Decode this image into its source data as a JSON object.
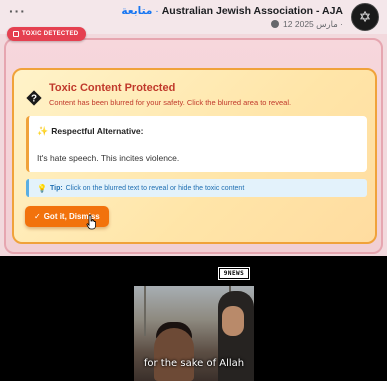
{
  "post": {
    "more_label": "···",
    "follow_label": "متابعة",
    "separator": "·",
    "page_name": "Australian Jewish Association - AJA",
    "date_text": "12 مارس 2025 ·",
    "avatar_symbol": "✡"
  },
  "badge": {
    "label": "TOXIC DETECTED"
  },
  "warning": {
    "title": "Toxic Content Protected",
    "subtitle": "Content has been blurred for your safety. Click the blurred area to reveal.",
    "alternative_heading": "Respectful Alternative:",
    "alternative_text": "It's hate speech. This incites violence.",
    "tip_label": "Tip:",
    "tip_text": "Click on the blurred text to reveal or hide the toxic content",
    "dismiss_label": "Got it, Dismiss"
  },
  "video": {
    "logo_text": "9NEWS",
    "subtitle": "for the sake of Allah"
  },
  "colors": {
    "danger": "#e54050",
    "warning_border": "#f0a23a",
    "button": "#f2720c",
    "tip": "#1f6fb2",
    "facebook_blue": "#1877f2"
  },
  "icons": [
    "more-icon",
    "globe-icon",
    "shield-icon",
    "warning-diamond-icon",
    "sparkle-icon",
    "lightbulb-icon",
    "check-icon",
    "hand-cursor-icon"
  ]
}
